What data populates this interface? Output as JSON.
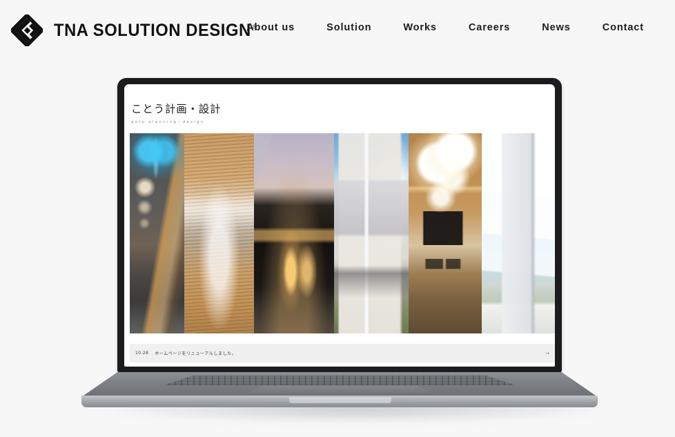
{
  "header": {
    "brand_name": "TNA SOLUTION DESIGN",
    "brand_registered_mark": "®",
    "logo_icon": "tna-diamond-logo-icon",
    "nav_items": [
      {
        "label": "About us"
      },
      {
        "label": "Solution"
      },
      {
        "label": "Works"
      },
      {
        "label": "Careers"
      },
      {
        "label": "News"
      },
      {
        "label": "Contact"
      }
    ]
  },
  "mockup": {
    "device": "laptop",
    "screen_site": {
      "title_jp": "ことう計画・設計",
      "title_romaji": "goto planning・design",
      "gallery": {
        "panels": [
          {
            "caption": "dark interior corridor with blue accent lights"
          },
          {
            "caption": "bright hall with wooden slat ceiling"
          },
          {
            "caption": "dusk exterior with warm lit windows"
          },
          {
            "caption": "two-story glass facade building in daylight"
          },
          {
            "caption": "warm living room with globe pendant lights and TV"
          },
          {
            "caption": "white modern building against blue sky"
          }
        ]
      },
      "news": {
        "date": "10.28",
        "text": "ホームページをリニューアルしました。",
        "next_arrow": "→"
      }
    }
  },
  "colors": {
    "page_background": "#f7f7f7",
    "text_primary": "#1b1b1b",
    "bezel": "#1c1c1e",
    "laptop_body": "#7e8186",
    "news_bar": "#f0f0f0"
  }
}
